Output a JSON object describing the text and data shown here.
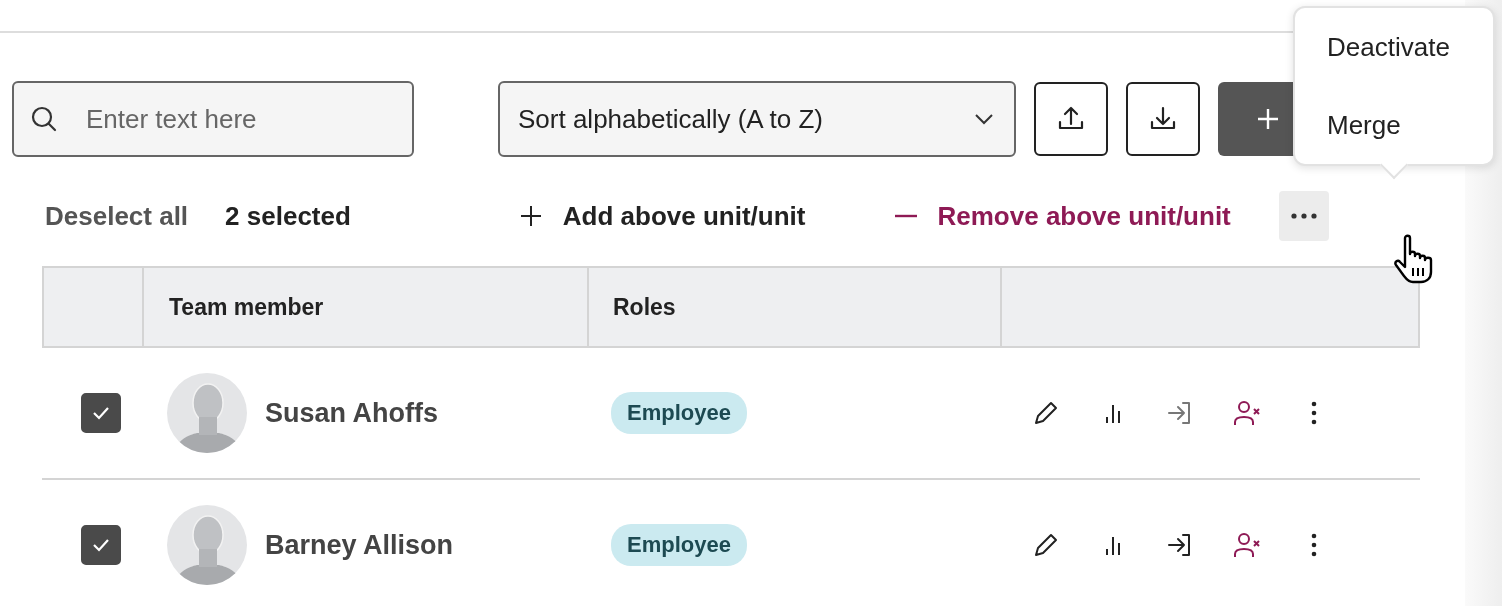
{
  "search": {
    "placeholder": "Enter text here"
  },
  "sort": {
    "value": "Sort alphabetically (A to Z)"
  },
  "selection_bar": {
    "deselect": "Deselect all",
    "count": "2 selected",
    "add": "Add above unit/unit",
    "remove": "Remove above unit/unit"
  },
  "menu": {
    "items": [
      {
        "label": "Deactivate"
      },
      {
        "label": "Merge"
      }
    ]
  },
  "table": {
    "columns": [
      "Team member",
      "Roles"
    ],
    "rows": [
      {
        "checked": true,
        "name": "Susan Ahoffs",
        "role": "Employee",
        "login_disabled": true
      },
      {
        "checked": true,
        "name": "Barney Allison",
        "role": "Employee",
        "login_disabled": false
      }
    ]
  }
}
